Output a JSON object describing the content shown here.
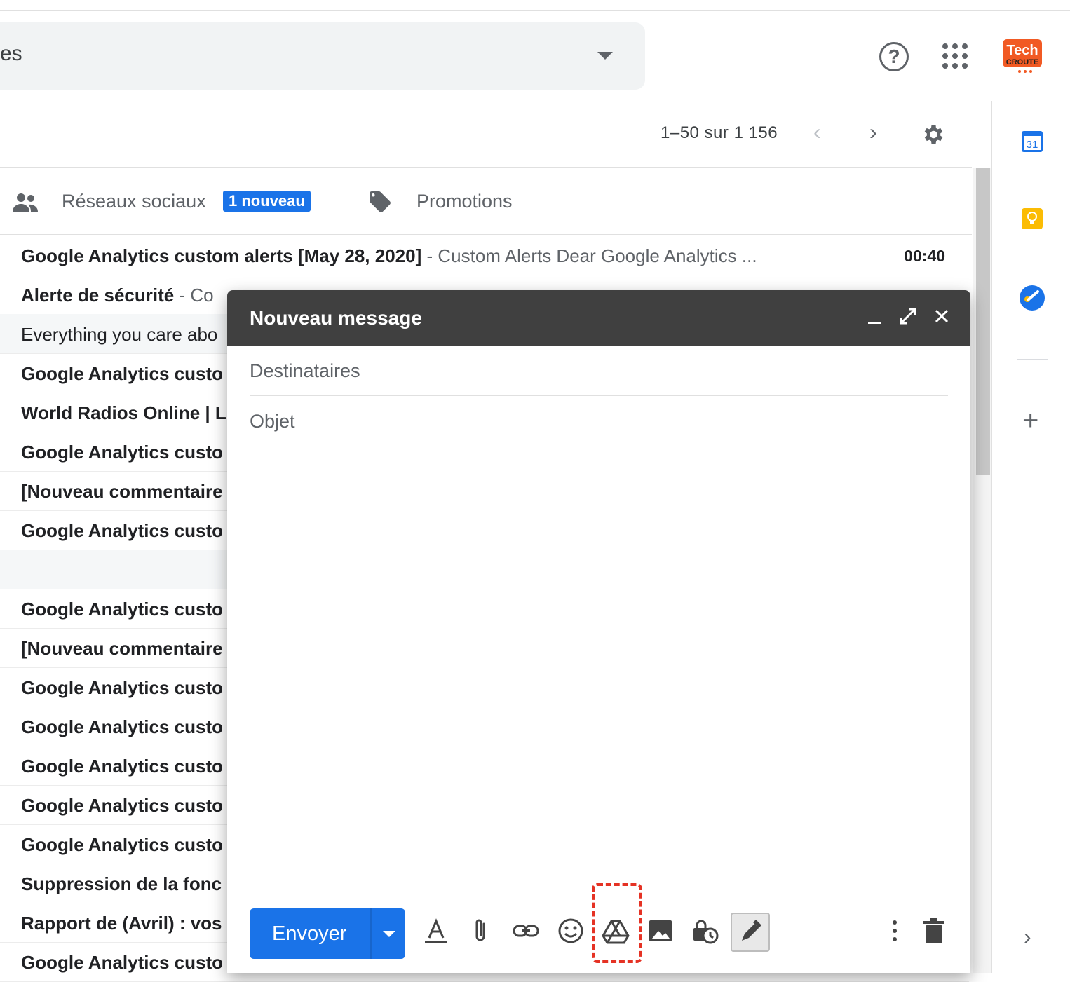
{
  "search": {
    "partial_text": "es"
  },
  "header": {
    "logo_text_top": "Tech",
    "logo_text_bottom": "CROUTE"
  },
  "toolbar": {
    "pagination": "1–50 sur 1 156"
  },
  "tabs": {
    "social": {
      "label": "Réseaux sociaux",
      "badge": "1 nouveau"
    },
    "promotions": {
      "label": "Promotions"
    }
  },
  "emails": [
    {
      "sender": "Google Analytics custom alerts [May 28, 2020]",
      "snippet": " - Custom Alerts Dear Google Analytics ...",
      "time": "00:40",
      "read": false
    },
    {
      "sender": "Alerte de sécurité",
      "snippet": " - Co",
      "time": "",
      "read": false
    },
    {
      "sender": "Everything you care abo",
      "snippet": "",
      "time": "",
      "read": true
    },
    {
      "sender": "Google Analytics custo",
      "snippet": "",
      "time": "",
      "read": false
    },
    {
      "sender": "World Radios Online | L",
      "snippet": "",
      "time": "",
      "read": false
    },
    {
      "sender": "Google Analytics custo",
      "snippet": "",
      "time": "",
      "read": false
    },
    {
      "sender": "[Nouveau commentaire",
      "snippet": "",
      "time": "",
      "read": false
    },
    {
      "sender": "Google Analytics custo",
      "snippet": "",
      "time": "",
      "read": false
    },
    {
      "sender": "",
      "snippet": "",
      "time": "",
      "read": true
    },
    {
      "sender": "Google Analytics custo",
      "snippet": "",
      "time": "",
      "read": false
    },
    {
      "sender": "[Nouveau commentaire",
      "snippet": "",
      "time": "",
      "read": false
    },
    {
      "sender": "Google Analytics custo",
      "snippet": "",
      "time": "",
      "read": false
    },
    {
      "sender": "Google Analytics custo",
      "snippet": "",
      "time": "",
      "read": false
    },
    {
      "sender": "Google Analytics custo",
      "snippet": "",
      "time": "",
      "read": false
    },
    {
      "sender": "Google Analytics custo",
      "snippet": "",
      "time": "",
      "read": false
    },
    {
      "sender": "Google Analytics custo",
      "snippet": "",
      "time": "",
      "read": false
    },
    {
      "sender": "Suppression de la fonc",
      "snippet": "",
      "time": "",
      "read": false
    },
    {
      "sender": "Rapport de (Avril) : vos",
      "snippet": "",
      "time": "",
      "read": false
    },
    {
      "sender": "Google Analytics custo",
      "snippet": "",
      "time": "",
      "read": false
    }
  ],
  "side_panel": {
    "calendar_day": "31"
  },
  "compose": {
    "title": "Nouveau message",
    "recipients_placeholder": "Destinataires",
    "subject_placeholder": "Objet",
    "send_label": "Envoyer"
  },
  "colors": {
    "primary": "#1a73e8",
    "compose_header": "#404040",
    "highlight": "#e53224"
  }
}
